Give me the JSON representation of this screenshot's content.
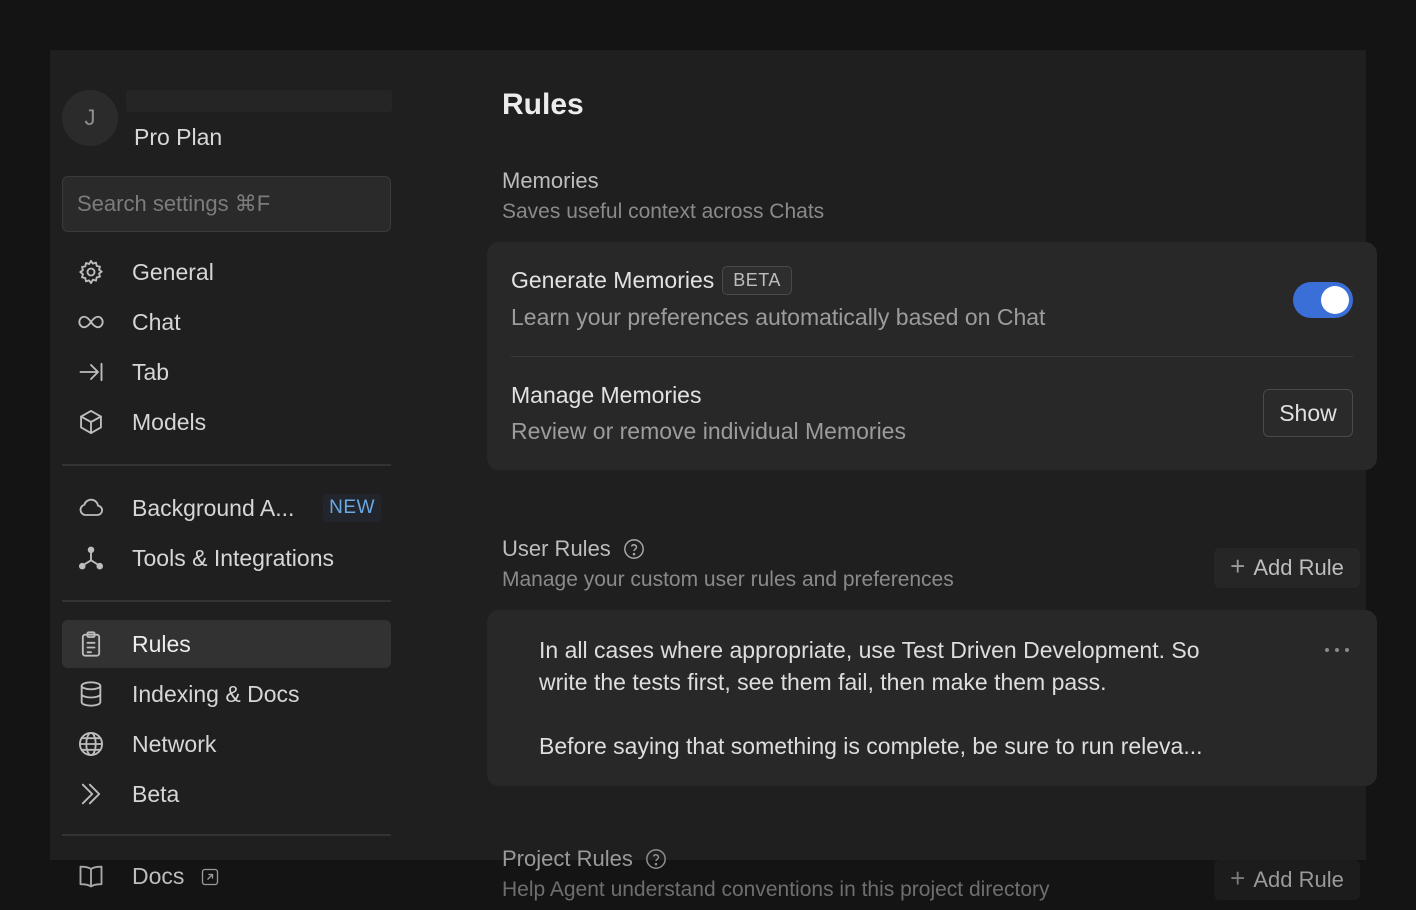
{
  "sidebar": {
    "profile": {
      "avatar_initial": "J",
      "plan": "Pro Plan"
    },
    "search": {
      "placeholder": "Search settings ⌘F"
    },
    "group1": [
      {
        "label": "General",
        "icon": "gear-icon"
      },
      {
        "label": "Chat",
        "icon": "infinity-icon"
      },
      {
        "label": "Tab",
        "icon": "tab-arrow-icon"
      },
      {
        "label": "Models",
        "icon": "cube-icon"
      }
    ],
    "group2": [
      {
        "label": "Background A...",
        "icon": "cloud-icon",
        "badge": "NEW"
      },
      {
        "label": "Tools & Integrations",
        "icon": "nodes-icon"
      }
    ],
    "group3": [
      {
        "label": "Rules",
        "icon": "clipboard-icon",
        "active": true
      },
      {
        "label": "Indexing & Docs",
        "icon": "database-icon"
      },
      {
        "label": "Network",
        "icon": "globe-icon"
      },
      {
        "label": "Beta",
        "icon": "double-chevron-icon"
      }
    ],
    "docs": {
      "label": "Docs",
      "icon": "book-icon"
    }
  },
  "main": {
    "title": "Rules",
    "memories": {
      "title": "Memories",
      "subtitle": "Saves useful context across Chats",
      "generate": {
        "title": "Generate Memories",
        "badge": "BETA",
        "subtitle": "Learn your preferences automatically based on Chat",
        "enabled": true
      },
      "manage": {
        "title": "Manage Memories",
        "subtitle": "Review or remove individual Memories",
        "button": "Show"
      }
    },
    "user_rules": {
      "title": "User Rules",
      "subtitle": "Manage your custom user rules and preferences",
      "add_button": "Add Rule",
      "rule_lines": [
        "In all cases where appropriate, use Test Driven Development. So",
        "write the tests first, see them fail, then make them pass.",
        "Before saying that something is complete, be sure to run releva..."
      ]
    },
    "project_rules": {
      "title": "Project Rules",
      "subtitle": "Help Agent understand conventions in this project directory",
      "add_button": "Add Rule"
    }
  },
  "colors": {
    "accent": "#3a6fd8",
    "new_badge": "#6aa8e6"
  }
}
